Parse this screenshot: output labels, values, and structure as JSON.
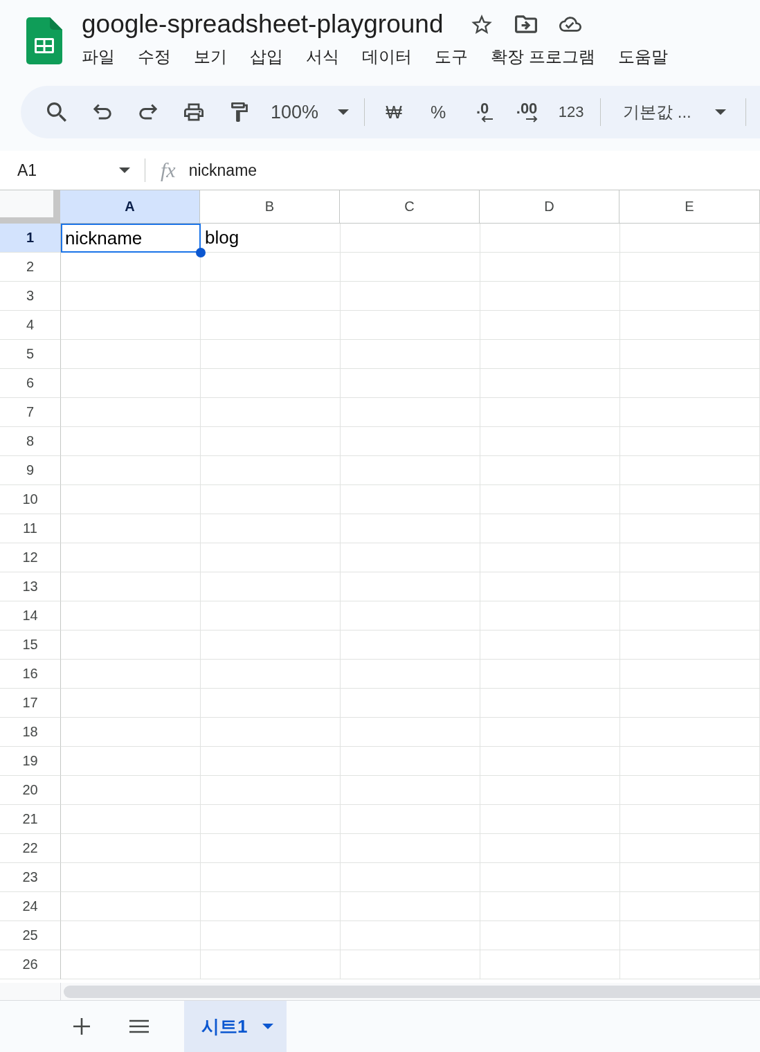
{
  "document": {
    "title": "google-spreadsheet-playground"
  },
  "menu": [
    "파일",
    "수정",
    "보기",
    "삽입",
    "서식",
    "데이터",
    "도구",
    "확장 프로그램",
    "도움말"
  ],
  "toolbar": {
    "zoom": "100%",
    "currency": "₩",
    "percent": "%",
    "decrease_decimal": ".0",
    "increase_decimal": ".00",
    "number_format": "123",
    "font": "기본값 ..."
  },
  "formula_bar": {
    "cell_reference": "A1",
    "fx": "fx",
    "value": "nickname"
  },
  "sheet": {
    "columns": [
      {
        "label": "A",
        "selected": true
      },
      {
        "label": "B",
        "selected": false
      },
      {
        "label": "C",
        "selected": false
      },
      {
        "label": "D",
        "selected": false
      },
      {
        "label": "E",
        "selected": false
      }
    ],
    "rows": [
      {
        "label": "1",
        "selected": true,
        "cells": [
          {
            "value": "nickname",
            "selected": true
          },
          {
            "value": "blog",
            "selected": false
          }
        ]
      },
      {
        "label": "2",
        "selected": false
      },
      {
        "label": "3",
        "selected": false
      },
      {
        "label": "4",
        "selected": false
      },
      {
        "label": "5",
        "selected": false
      },
      {
        "label": "6",
        "selected": false
      },
      {
        "label": "7",
        "selected": false
      },
      {
        "label": "8",
        "selected": false
      },
      {
        "label": "9",
        "selected": false
      },
      {
        "label": "10",
        "selected": false
      },
      {
        "label": "11",
        "selected": false
      },
      {
        "label": "12",
        "selected": false
      },
      {
        "label": "13",
        "selected": false
      },
      {
        "label": "14",
        "selected": false
      },
      {
        "label": "15",
        "selected": false
      },
      {
        "label": "16",
        "selected": false
      },
      {
        "label": "17",
        "selected": false
      },
      {
        "label": "18",
        "selected": false
      },
      {
        "label": "19",
        "selected": false
      },
      {
        "label": "20",
        "selected": false
      },
      {
        "label": "21",
        "selected": false
      },
      {
        "label": "22",
        "selected": false
      },
      {
        "label": "23",
        "selected": false
      },
      {
        "label": "24",
        "selected": false
      },
      {
        "label": "25",
        "selected": false
      },
      {
        "label": "26",
        "selected": false
      }
    ]
  },
  "sheet_tabs": [
    {
      "label": "시트1",
      "selected": true
    }
  ]
}
